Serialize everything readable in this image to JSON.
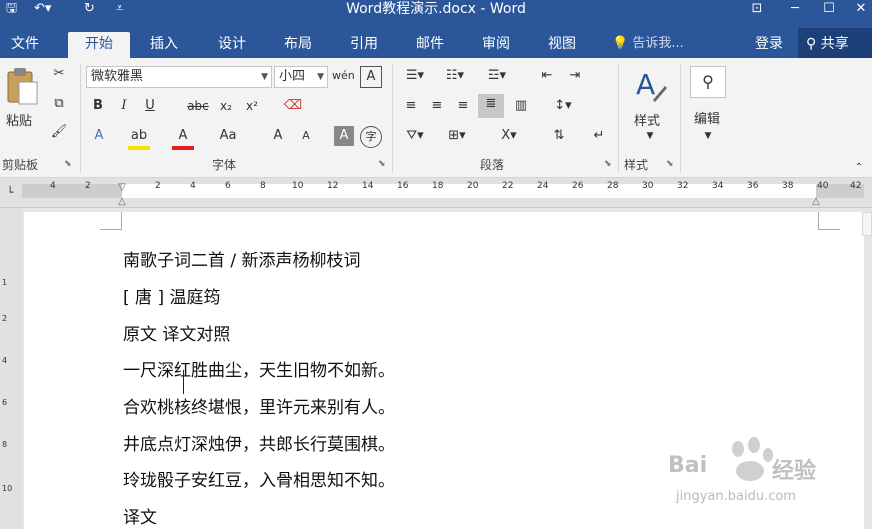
{
  "window": {
    "title": "Word教程演示.docx - Word",
    "quick_access": [
      "save-icon",
      "undo-icon",
      "redo-icon",
      "customize-icon"
    ],
    "controls": [
      "ribbon-display-icon",
      "minimize-icon",
      "maximize-icon",
      "close-icon"
    ]
  },
  "tabs": [
    "文件",
    "开始",
    "插入",
    "设计",
    "布局",
    "引用",
    "邮件",
    "审阅",
    "视图"
  ],
  "tell_me": "告诉我...",
  "login": "登录",
  "share": "共享",
  "ribbon": {
    "clipboard": {
      "label": "剪贴板",
      "paste": "粘贴"
    },
    "font": {
      "label": "字体",
      "font_name": "微软雅黑",
      "font_size": "小四",
      "buttons": [
        "B",
        "I",
        "U",
        "abc",
        "x₂",
        "x²",
        "A",
        "A",
        "Aa",
        "A",
        "A",
        "A",
        "字"
      ]
    },
    "paragraph": {
      "label": "段落"
    },
    "styles": {
      "label": "样式",
      "button": "样式"
    },
    "editing": {
      "button": "编辑"
    }
  },
  "ruler": {
    "ticks": [
      "4",
      "2",
      "2",
      "4",
      "6",
      "8",
      "10",
      "12",
      "14",
      "16",
      "18",
      "20",
      "22",
      "24",
      "26",
      "28",
      "30",
      "32",
      "34",
      "36",
      "38",
      "40",
      "42"
    ],
    "vertical_ticks": [
      "1",
      "2",
      "4",
      "6",
      "8",
      "10"
    ]
  },
  "document": {
    "lines": [
      "南歌子词二首 / 新添声杨柳枝词",
      "[ 唐 ] 温庭筠",
      "原文  译文对照",
      "一尺深红胜曲尘，天生旧物不如新。",
      "合欢桃核终堪恨，里许元来别有人。",
      "井底点灯深烛伊，共郎长行莫围棋。",
      "玲珑骰子安红豆，入骨相思知不知。",
      "译文"
    ]
  },
  "watermark": {
    "brand": "Bai",
    "brand_suffix": "经验",
    "url": "jingyan.baidu.com"
  }
}
